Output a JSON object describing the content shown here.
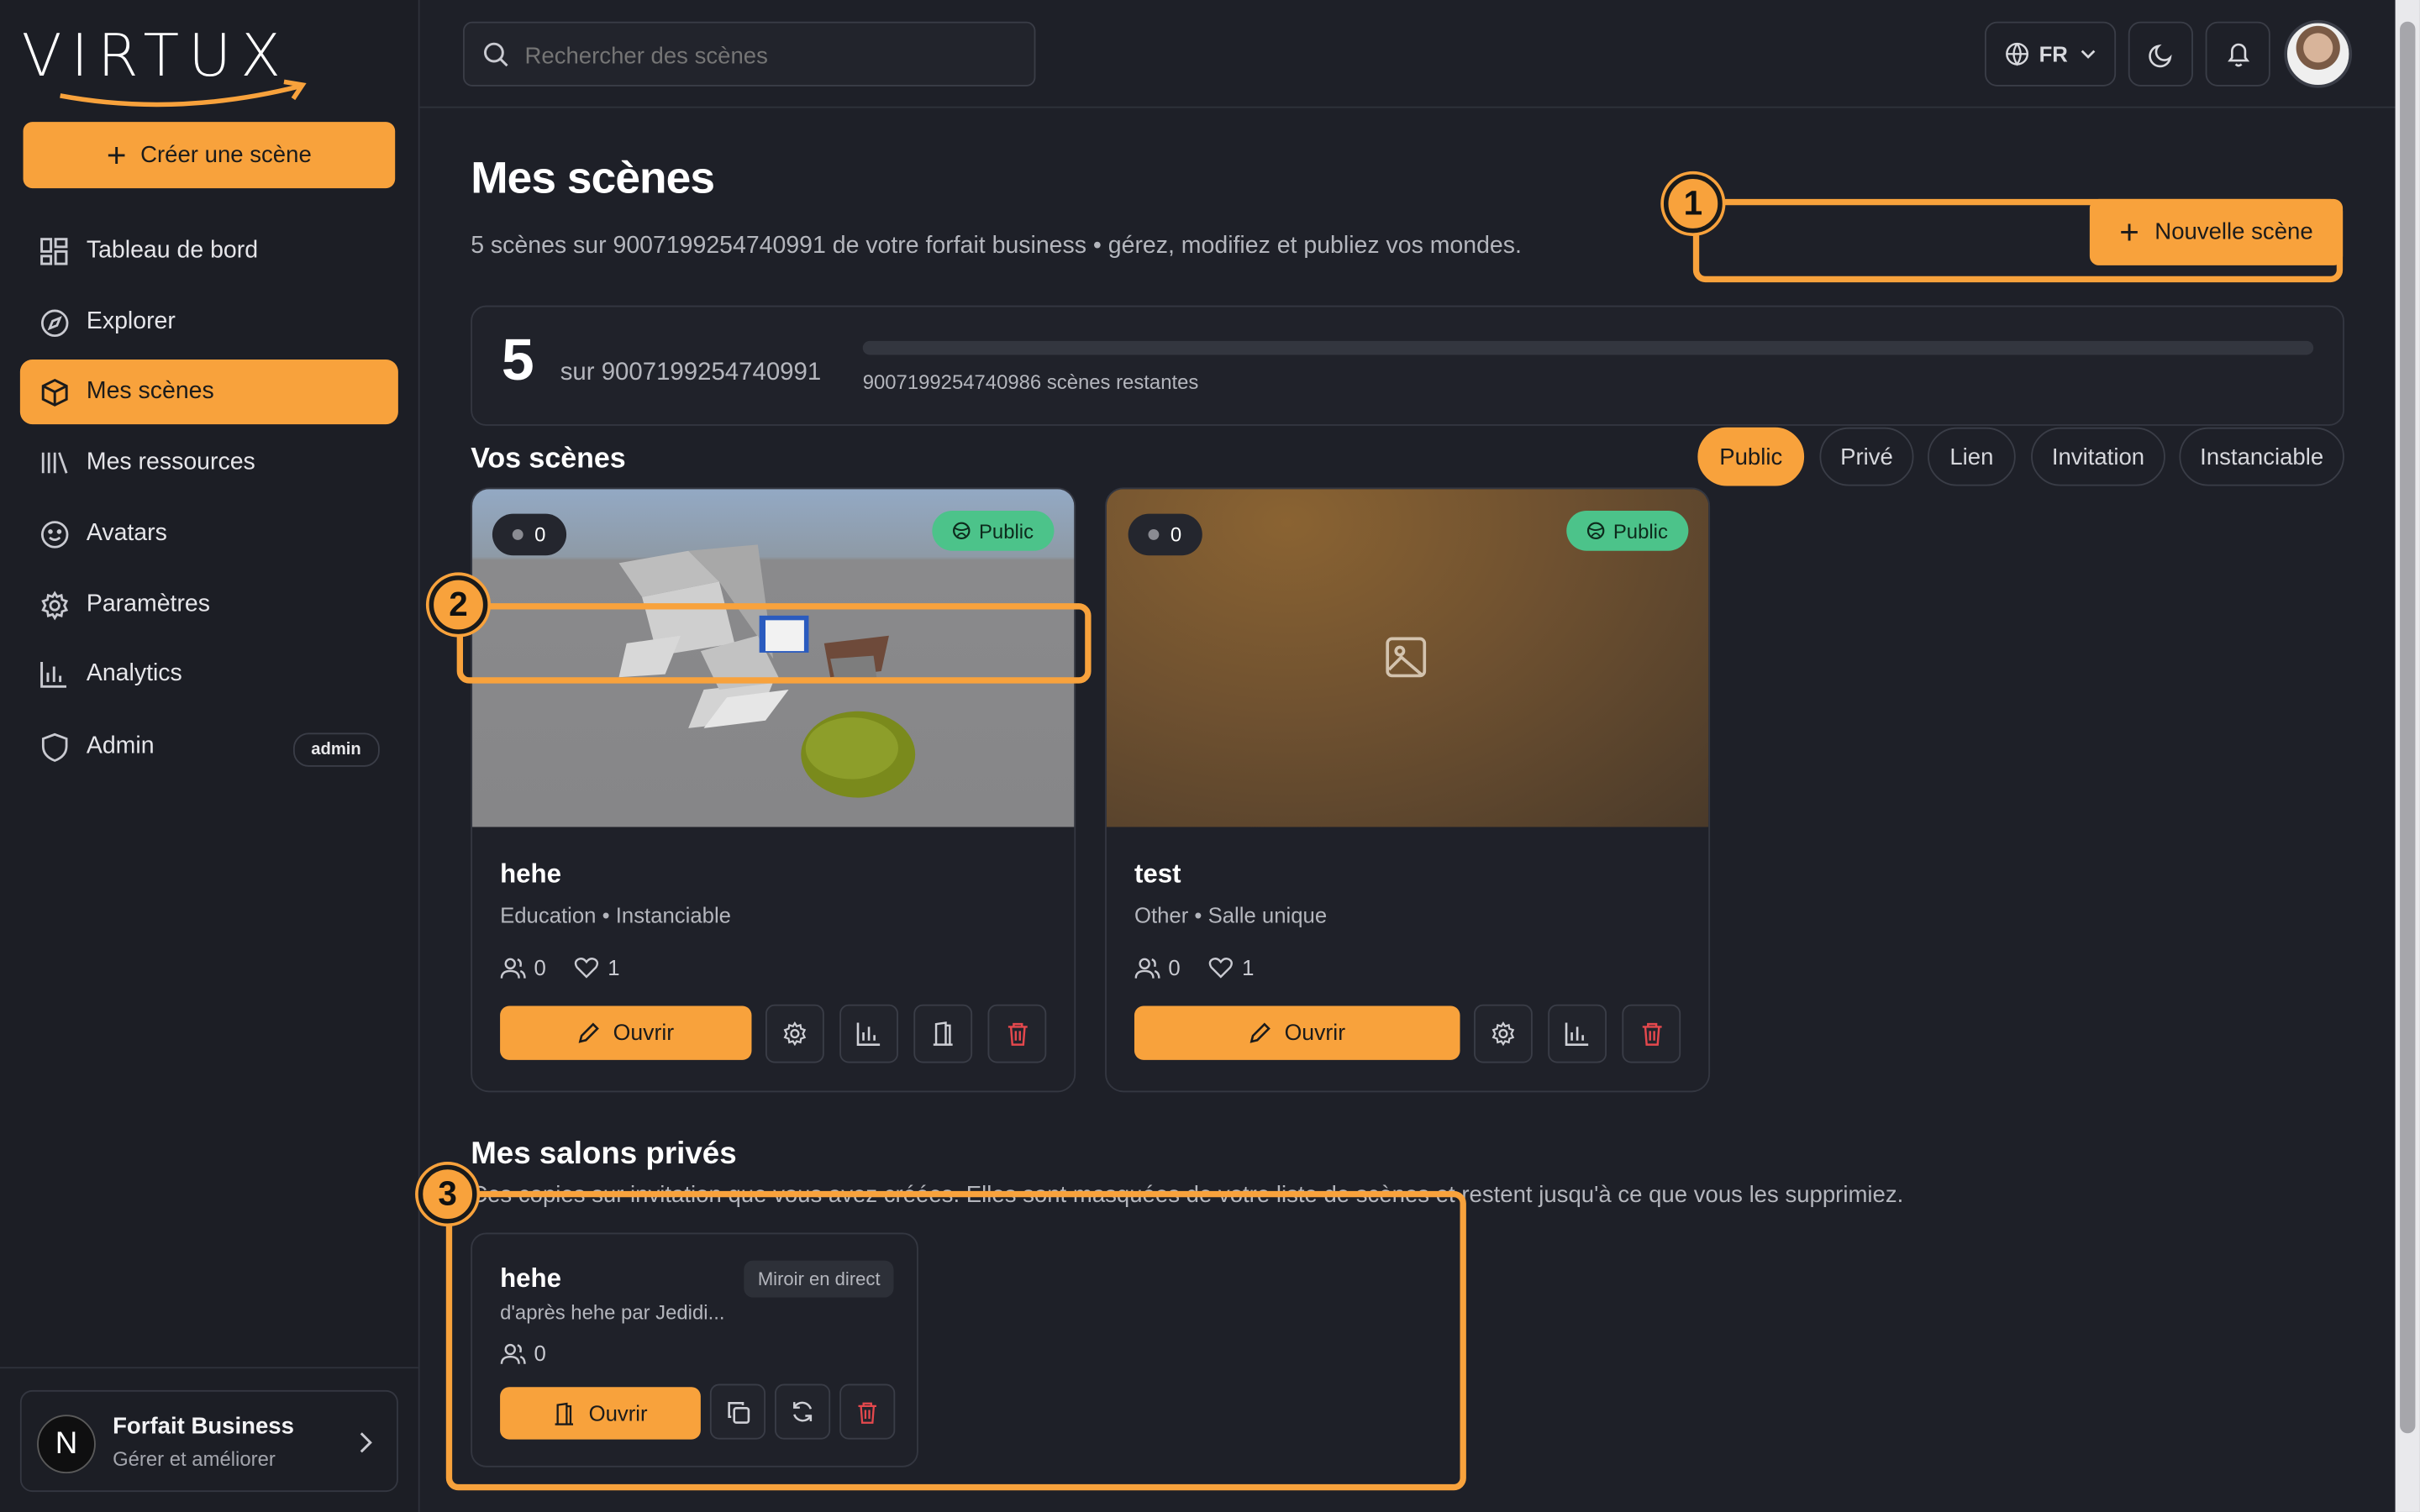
{
  "app": {
    "logo_text": "VIRTUX"
  },
  "sidebar": {
    "create_label": "Créer une scène",
    "items": [
      {
        "label": "Tableau de bord",
        "icon": "dashboard-icon"
      },
      {
        "label": "Explorer",
        "icon": "compass-icon"
      },
      {
        "label": "Mes scènes",
        "icon": "cube-icon",
        "active": true
      },
      {
        "label": "Mes ressources",
        "icon": "library-icon"
      },
      {
        "label": "Avatars",
        "icon": "smile-icon"
      },
      {
        "label": "Paramètres",
        "icon": "gear-icon"
      },
      {
        "label": "Analytics",
        "icon": "bar-chart-icon"
      },
      {
        "label": "Admin",
        "icon": "shield-icon",
        "badge": "admin"
      }
    ],
    "plan": {
      "title": "Forfait Business",
      "subtitle": "Gérer et améliorer",
      "avatar_letter": "N"
    }
  },
  "topbar": {
    "search_placeholder": "Rechercher des scènes",
    "language": "FR"
  },
  "page": {
    "title": "Mes scènes",
    "subtitle": "5 scènes sur 9007199254740991 de votre forfait business • gérez, modifiez et publiez vos mondes.",
    "new_scene_label": "Nouvelle scène"
  },
  "quota": {
    "used": "5",
    "of_label": "sur 9007199254740991",
    "remaining_label": "9007199254740986 scènes restantes",
    "fill_fraction": 0.0
  },
  "scenes_section": {
    "title": "Vos scènes",
    "filters": [
      "Public",
      "Privé",
      "Lien",
      "Invitation",
      "Instanciable"
    ],
    "active_filter": "Public"
  },
  "scenes": [
    {
      "title": "hehe",
      "meta": "Education • Instanciable",
      "online": "0",
      "visitors": "0",
      "likes": "1",
      "visibility": "Public",
      "open_label": "Ouvrir"
    },
    {
      "title": "test",
      "meta": "Other • Salle unique",
      "online": "0",
      "visitors": "0",
      "likes": "1",
      "visibility": "Public",
      "open_label": "Ouvrir"
    }
  ],
  "private_rooms": {
    "title": "Mes salons privés",
    "description": "Ces copies sur invitation que vous avez créées. Elles sont masquées de votre liste de scènes et restent jusqu'à ce que vous les supprimiez.",
    "rooms": [
      {
        "title": "hehe",
        "origin": "d'après hehe par Jedidi...",
        "badge": "Miroir en direct",
        "visitors": "0",
        "open_label": "Ouvrir"
      }
    ]
  },
  "callouts": [
    "1",
    "2",
    "3"
  ],
  "colors": {
    "accent": "#f8a23c",
    "background": "#1e2028",
    "public_badge": "#4cc38a",
    "danger": "#e5484d"
  }
}
